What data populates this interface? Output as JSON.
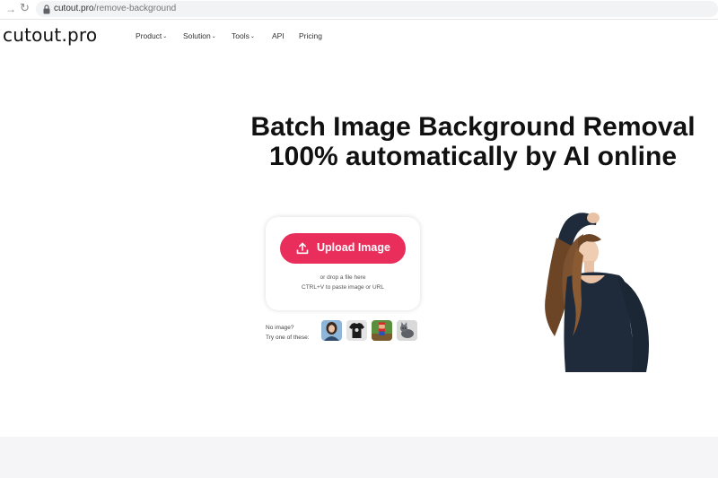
{
  "browser": {
    "back_glyph": "→",
    "reload_glyph": "↻",
    "url_host": "cutout.pro",
    "url_path": "/remove-background"
  },
  "header": {
    "logo": "cutout.pro",
    "nav": [
      {
        "label": "Product",
        "has_menu": true
      },
      {
        "label": "Solution",
        "has_menu": true
      },
      {
        "label": "Tools",
        "has_menu": true
      },
      {
        "label": "API",
        "has_menu": false
      },
      {
        "label": "Pricing",
        "has_menu": false
      }
    ]
  },
  "hero": {
    "title_line1": "Batch Image Background Removal",
    "title_line2": "100% automatically by AI online"
  },
  "upload": {
    "button_label": "Upload Image",
    "drop_text": "or drop a file here",
    "paste_text": "CTRL+V to paste image or URL"
  },
  "samples": {
    "line1": "No image?",
    "line2": "Try one of these:",
    "items": [
      "woman-portrait-sample",
      "tshirt-sample",
      "toy-figure-sample",
      "cat-sample"
    ]
  },
  "colors": {
    "accent": "#ea2e5c",
    "footer_band": "#f5f5f7"
  },
  "icons": {
    "back": "arrow-icon",
    "reload": "reload-icon",
    "lock": "lock-icon",
    "upload": "upload-icon",
    "chevron": "chevron-down-icon"
  }
}
